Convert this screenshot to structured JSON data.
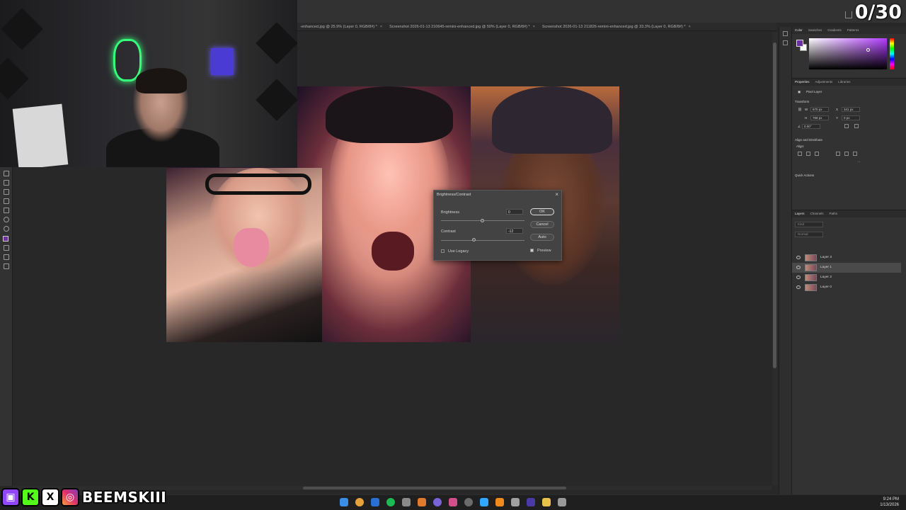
{
  "overlay": {
    "counter": "0/30",
    "handle": "BEEMSKIII",
    "socials": [
      "twitch-icon",
      "kick-icon",
      "x-icon",
      "instagram-icon"
    ]
  },
  "document_tabs": [
    {
      "label": "-enhanced.jpg @ 25.9% (Layer 0, RGB/8#) *"
    },
    {
      "label": "Screenshot 2026-01-13 210645-remini-enhanced.jpg @ 50% (Layer 0, RGB/8#) *"
    },
    {
      "label": "Screenshot 2026-01-13 211826-remini-enhanced.jpg @ 33.3% (Layer 0, RGB/8#) *"
    }
  ],
  "dialog": {
    "title": "Brightness/Contrast",
    "brightness_label": "Brightness",
    "brightness_value": "0",
    "contrast_label": "Contrast",
    "contrast_value": "-12",
    "ok_label": "OK",
    "cancel_label": "Cancel",
    "auto_label": "Auto",
    "use_legacy_label": "Use Legacy",
    "use_legacy_checked": false,
    "preview_label": "Preview",
    "preview_checked": true
  },
  "color_panel": {
    "tabs": [
      "Color",
      "Swatches",
      "Gradients",
      "Patterns"
    ],
    "foreground": "#6b2fa0",
    "background": "#ffffff"
  },
  "properties_panel": {
    "tabs": [
      "Properties",
      "Adjustments",
      "Libraries"
    ],
    "layer_type": "Pixel Layer",
    "transform_label": "Transform",
    "w": "670 px",
    "h": "768 px",
    "x": "341 px",
    "y": "0 px",
    "angle": "0.00°",
    "align_label": "Align and Distribute",
    "align_sub": "Align:",
    "quick_actions_label": "Quick Actions"
  },
  "layers_panel": {
    "tabs": [
      "Layers",
      "Channels",
      "Paths"
    ],
    "search_placeholder": "Kind",
    "blend_mode": "Normal",
    "layers": [
      {
        "name": "Layer 3",
        "selected": false
      },
      {
        "name": "Layer 1",
        "selected": true
      },
      {
        "name": "Layer 2",
        "selected": false
      },
      {
        "name": "Layer 0",
        "selected": false
      }
    ]
  },
  "taskbar": {
    "time": "9:24 PM",
    "date": "1/13/2026"
  }
}
